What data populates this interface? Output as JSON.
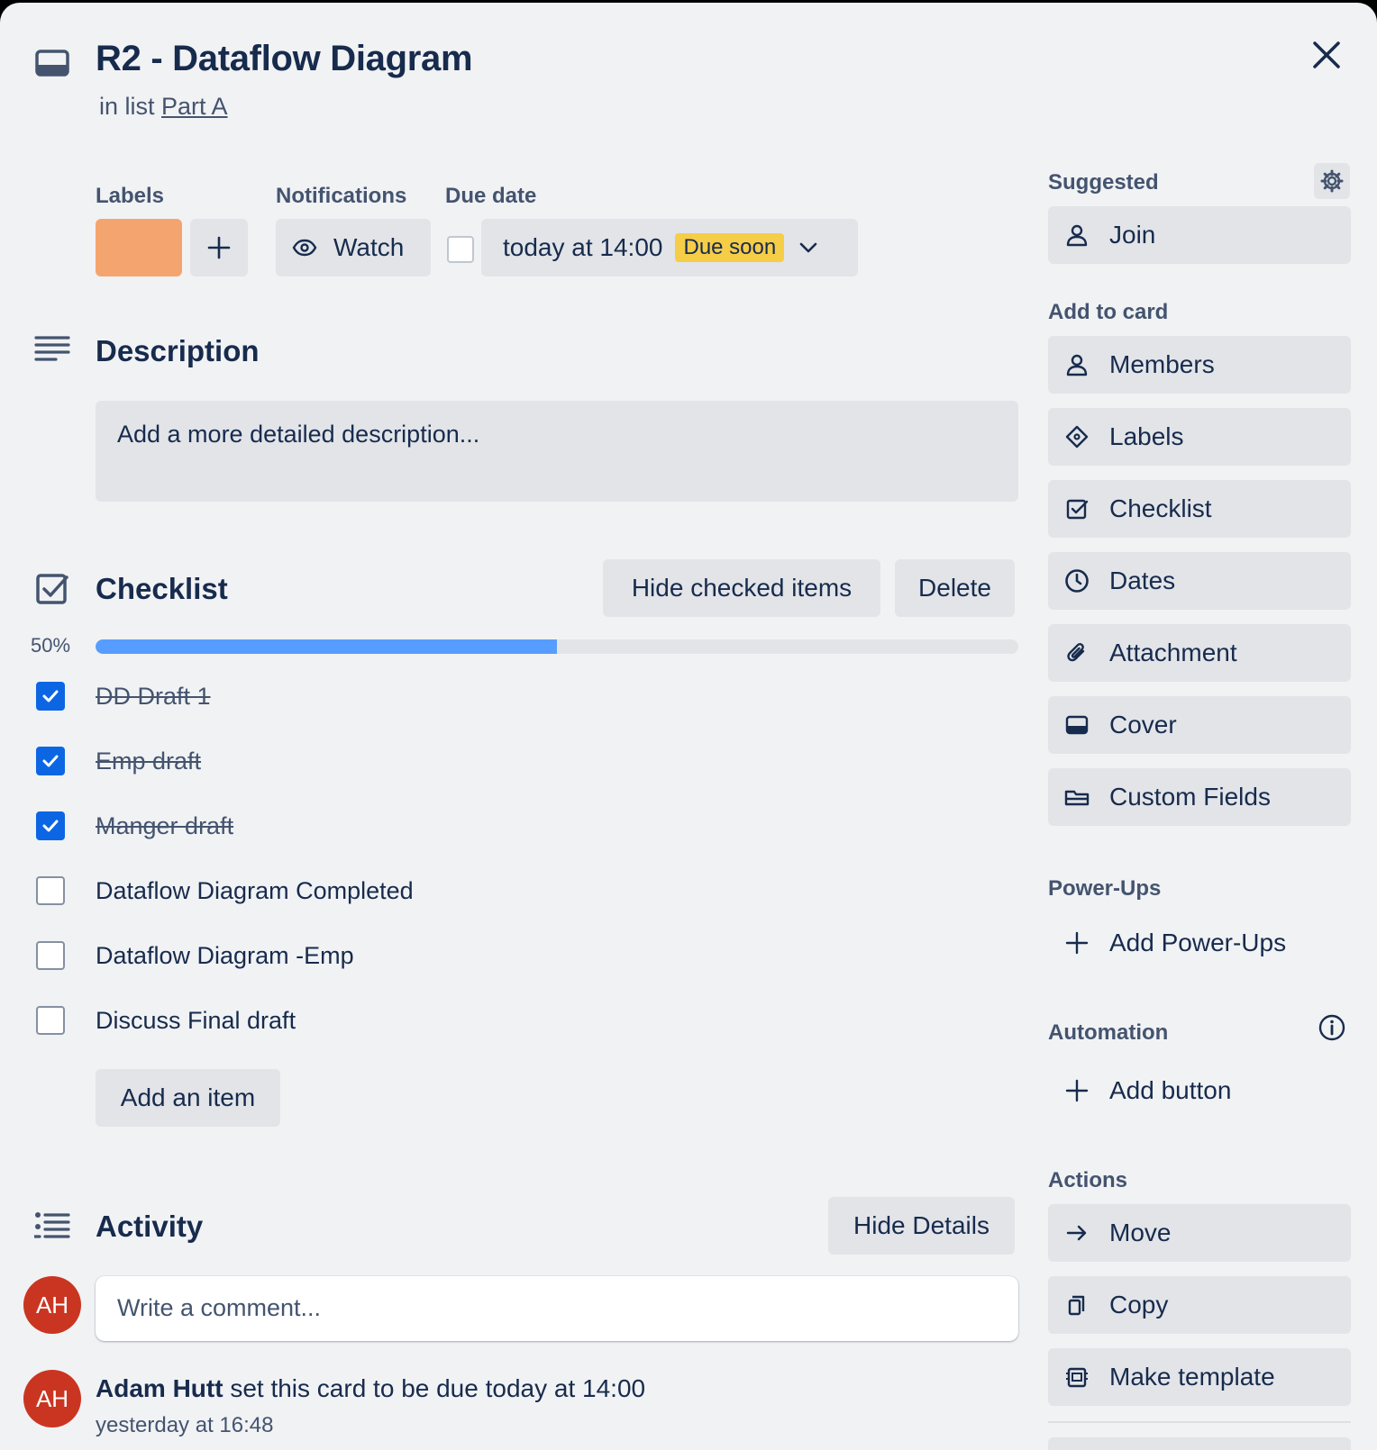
{
  "card": {
    "title": "R2 - Dataflow Diagram",
    "in_list_prefix": "in list",
    "list_name": "Part A"
  },
  "labels_section": {
    "heading": "Labels",
    "label_color": "#f4a56f",
    "add_label": "+"
  },
  "notifications": {
    "heading": "Notifications",
    "watch_label": "Watch"
  },
  "due_date": {
    "heading": "Due date",
    "value": "today at 14:00",
    "badge": "Due soon",
    "badge_color": "#f5cd47"
  },
  "description": {
    "heading": "Description",
    "placeholder": "Add a more detailed description..."
  },
  "checklist": {
    "heading": "Checklist",
    "hide_checked_label": "Hide checked items",
    "delete_label": "Delete",
    "progress_text": "50%",
    "progress": 0.5,
    "items": [
      {
        "text": "DD Draft 1",
        "checked": true
      },
      {
        "text": "Emp draft",
        "checked": true
      },
      {
        "text": "Manger draft",
        "checked": true
      },
      {
        "text": "Dataflow Diagram Completed",
        "checked": false
      },
      {
        "text": "Dataflow Diagram -Emp",
        "checked": false
      },
      {
        "text": "Discuss Final draft",
        "checked": false
      }
    ],
    "add_item_label": "Add an item"
  },
  "activity": {
    "heading": "Activity",
    "hide_details_label": "Hide Details",
    "avatar_initials": "AH",
    "avatar_color": "#ca3521",
    "comment_placeholder": "Write a comment...",
    "entries": [
      {
        "user": "Adam Hutt",
        "action": " set this card to be due today at 14:00",
        "time": "yesterday at 16:48",
        "initials": "AH"
      }
    ]
  },
  "sidebar": {
    "suggested_heading": "Suggested",
    "join_label": "Join",
    "add_to_card_heading": "Add to card",
    "add_to_card": [
      {
        "label": "Members",
        "icon": "person-icon"
      },
      {
        "label": "Labels",
        "icon": "tag-icon"
      },
      {
        "label": "Checklist",
        "icon": "checklist-icon"
      },
      {
        "label": "Dates",
        "icon": "clock-icon"
      },
      {
        "label": "Attachment",
        "icon": "paperclip-icon"
      },
      {
        "label": "Cover",
        "icon": "cover-icon"
      },
      {
        "label": "Custom Fields",
        "icon": "custom-fields-icon"
      }
    ],
    "powerups_heading": "Power-Ups",
    "add_powerups_label": "Add Power-Ups",
    "automation_heading": "Automation",
    "add_button_label": "Add button",
    "actions_heading": "Actions",
    "actions": [
      {
        "label": "Move",
        "icon": "arrow-right-icon"
      },
      {
        "label": "Copy",
        "icon": "copy-icon"
      },
      {
        "label": "Make template",
        "icon": "template-icon"
      }
    ]
  },
  "colors": {
    "accent_blue": "#0c66e4",
    "progress_blue": "#579dff",
    "button_gray": "#e2e4e8",
    "panel_bg": "#f1f2f4"
  }
}
